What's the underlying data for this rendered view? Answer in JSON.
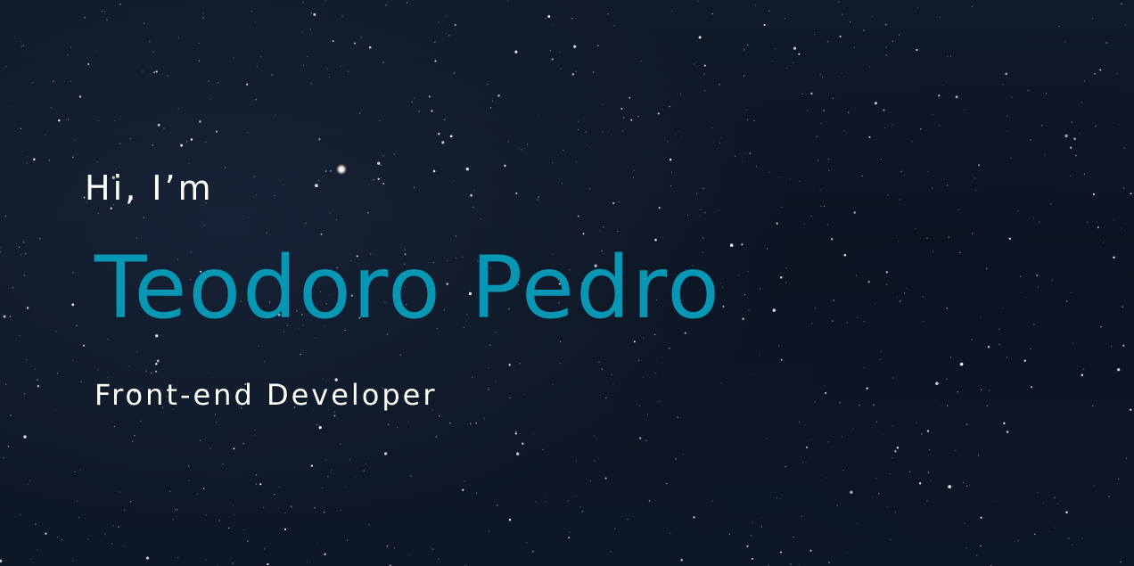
{
  "hero": {
    "greeting": "Hi, I’m",
    "name": "Teodoro Pedro",
    "role": "Front-end Developer"
  },
  "colors": {
    "background": "#0d1724",
    "name_accent": "#0797b5",
    "text": "#ffffff"
  }
}
